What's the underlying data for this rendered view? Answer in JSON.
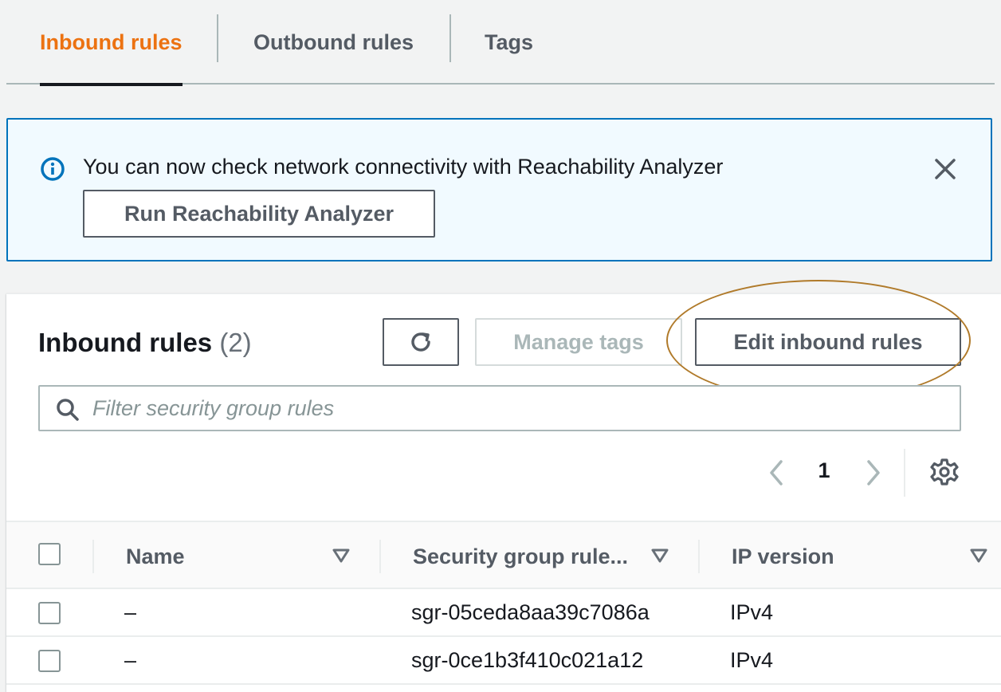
{
  "tabs": [
    {
      "label": "Inbound rules",
      "active": true
    },
    {
      "label": "Outbound rules",
      "active": false
    },
    {
      "label": "Tags",
      "active": false
    }
  ],
  "alert": {
    "message": "You can now check network connectivity with Reachability Analyzer",
    "button_label": "Run Reachability Analyzer",
    "icon": "info-icon",
    "close_icon": "close-icon"
  },
  "panel": {
    "title": "Inbound rules",
    "count": "(2)",
    "refresh_icon": "refresh-icon",
    "manage_tags_label": "Manage tags",
    "edit_label": "Edit inbound rules",
    "search_placeholder": "Filter security group rules",
    "page_number": "1"
  },
  "table": {
    "columns": [
      "Name",
      "Security group rule...",
      "IP version"
    ],
    "rows": [
      {
        "name": "–",
        "rule_id": "sgr-05ceda8aa39c7086a",
        "ip_version": "IPv4"
      },
      {
        "name": "–",
        "rule_id": "sgr-0ce1b3f410c021a12",
        "ip_version": "IPv4"
      }
    ]
  },
  "colors": {
    "active_tab": "#ec7211",
    "alert_border": "#0073bb",
    "alert_bg": "#f1faff",
    "highlight_ring": "#b07a2a"
  }
}
